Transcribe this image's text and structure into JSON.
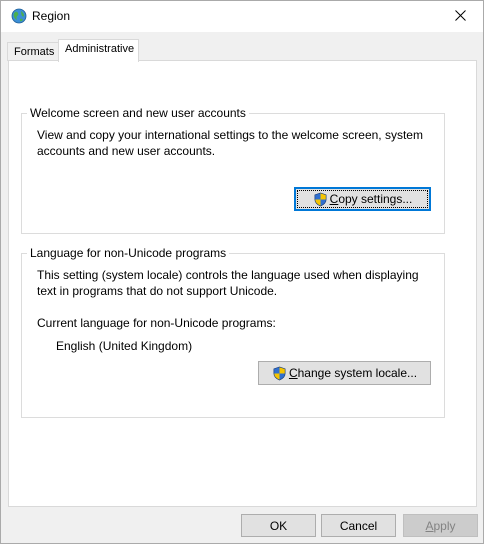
{
  "window": {
    "title": "Region"
  },
  "tabs": [
    {
      "label": "Formats",
      "active": false
    },
    {
      "label": "Administrative",
      "active": true
    }
  ],
  "welcome_group": {
    "legend": "Welcome screen and new user accounts",
    "description": "View and copy your international settings to the welcome screen, system accounts and new user accounts.",
    "copy_button": {
      "accesskey": "C",
      "rest": "opy settings..."
    }
  },
  "unicode_group": {
    "legend": "Language for non-Unicode programs",
    "description": "This setting (system locale) controls the language used when displaying text in programs that do not support Unicode.",
    "current_label": "Current language for non-Unicode programs:",
    "current_value": "English (United Kingdom)",
    "change_button": {
      "accesskey": "C",
      "rest": "hange system locale..."
    }
  },
  "footer": {
    "ok_label": "OK",
    "cancel_label": "Cancel",
    "apply_accesskey": "A",
    "apply_rest": "pply"
  },
  "colors": {
    "accent": "#0078d7",
    "button_face": "#e1e1e1",
    "dialog_bg": "#f0f0f0"
  },
  "icons": {
    "app": "globe-icon",
    "close": "close-icon",
    "uac": "uac-shield-icon"
  }
}
